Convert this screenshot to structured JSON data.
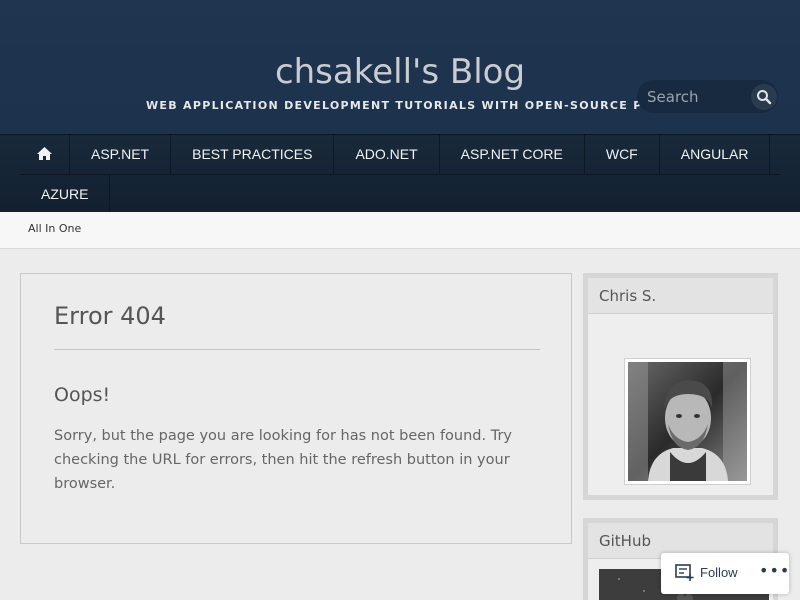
{
  "header": {
    "site_title": "chsakell's Blog",
    "tagline": "WEB APPLICATION DEVELOPMENT TUTORIALS WITH OPEN-SOURCE PROJECTS"
  },
  "search": {
    "placeholder": "Search",
    "icon": "search-icon"
  },
  "nav": {
    "home_icon": "home-icon",
    "items": [
      "ASP.NET",
      "BEST PRACTICES",
      "ADO.NET",
      "ASP.NET CORE",
      "WCF",
      "ANGULAR",
      "AZURE"
    ]
  },
  "subnav": {
    "link": "All In One"
  },
  "main": {
    "title": "Error 404",
    "subtitle": "Oops!",
    "message": "Sorry, but the page you are looking for has not been found. Try checking the URL for errors, then hit the refresh button in your browser."
  },
  "sidebar": {
    "widget1_title": "Chris S.",
    "widget2_title": "GitHub"
  },
  "follow": {
    "label": "Follow",
    "more": "•••"
  },
  "colors": {
    "header_bg": "#1f3550",
    "nav_bg": "#14212f",
    "page_bg": "#ececec"
  }
}
